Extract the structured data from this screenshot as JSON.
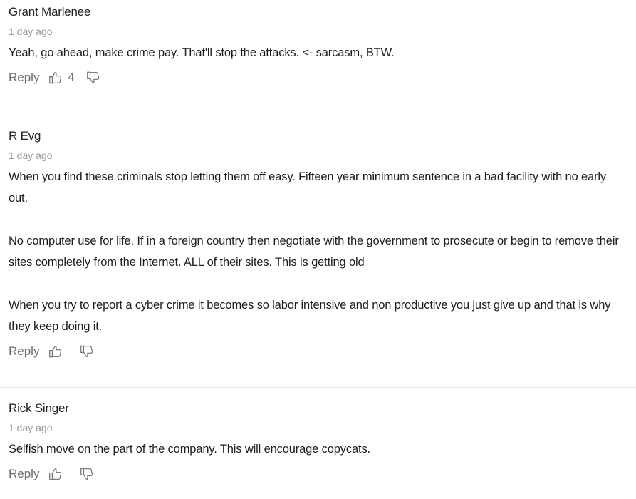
{
  "comments": [
    {
      "author": "Grant Marlenee",
      "time": "1 day ago",
      "paragraphs": [
        "Yeah, go ahead, make crime pay.  That'll stop the attacks.  <- sarcasm, BTW."
      ],
      "reply_label": "Reply",
      "upvotes": "4",
      "upvote_icon": "thumbs-up-icon",
      "downvote_icon": "thumbs-down-icon"
    },
    {
      "author": "R Evg",
      "time": "1 day ago",
      "paragraphs": [
        "When you find these criminals stop letting them off easy.  Fifteen year minimum sentence in a bad facility with no early out.",
        "",
        "No computer use for life.  If in a foreign country then negotiate with the government to prosecute or begin to remove their sites completely from the Internet.  ALL of their sites.  This is getting old",
        "",
        "When you try to report a cyber crime it becomes so labor intensive and non productive you just give up and that is why they keep doing it."
      ],
      "reply_label": "Reply",
      "upvotes": "",
      "upvote_icon": "thumbs-up-icon",
      "downvote_icon": "thumbs-down-icon"
    },
    {
      "author": "Rick Singer",
      "time": "1 day ago",
      "paragraphs": [
        "Selfish move on the part of the company.  This will encourage copycats."
      ],
      "reply_label": "Reply",
      "upvotes": "",
      "upvote_icon": "thumbs-up-icon",
      "downvote_icon": "thumbs-down-icon"
    }
  ]
}
